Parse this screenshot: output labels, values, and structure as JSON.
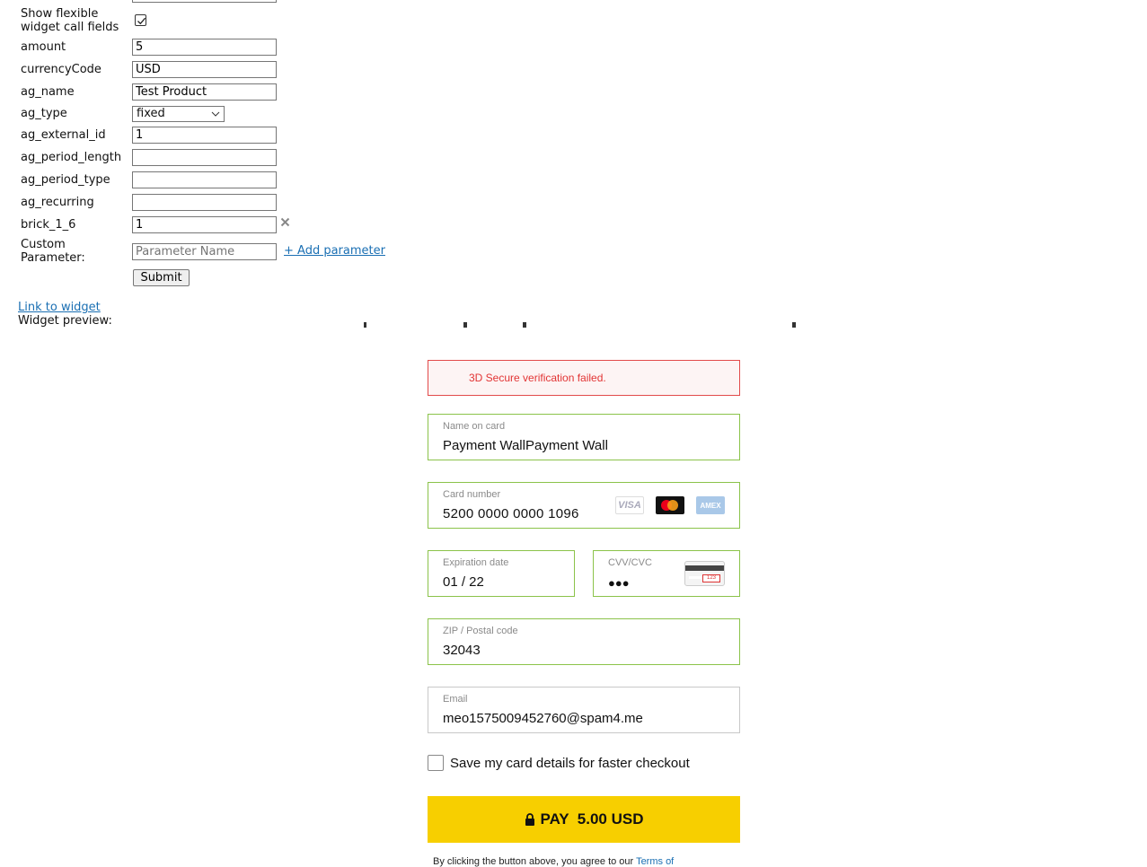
{
  "form": {
    "show_flexible_label_1": "Show flexible",
    "show_flexible_label_2": "widget call fields",
    "rows": [
      {
        "label": "amount",
        "value": "5"
      },
      {
        "label": "currencyCode",
        "value": "USD"
      },
      {
        "label": "ag_name",
        "value": "Test Product"
      },
      {
        "label": "ag_type",
        "value": "fixed"
      },
      {
        "label": "ag_external_id",
        "value": "1"
      },
      {
        "label": "ag_period_length",
        "value": ""
      },
      {
        "label": "ag_period_type",
        "value": ""
      },
      {
        "label": "ag_recurring",
        "value": ""
      },
      {
        "label": "brick_1_6",
        "value": "1"
      }
    ],
    "custom_param_label_1": "Custom",
    "custom_param_label_2": "Parameter:",
    "custom_param_placeholder": "Parameter Name",
    "add_parameter": "+ Add parameter",
    "submit": "Submit",
    "link_to_widget": "Link to widget",
    "widget_preview": "Widget preview:"
  },
  "widget": {
    "error": "3D Secure verification failed.",
    "name_label": "Name on card",
    "name_value": "Payment WallPayment Wall",
    "card_label": "Card number",
    "card_value": "5200 0000 0000 1096",
    "expiry_label": "Expiration date",
    "expiry_value": "01 / 22",
    "cvv_label": "CVV/CVC",
    "cvv_value": "●●●",
    "zip_label": "ZIP / Postal code",
    "zip_value": "32043",
    "email_label": "Email",
    "email_value": "meo1575009452760@spam4.me",
    "save_card": "Save my card details for faster checkout",
    "pay_button": "PAY  5.00 USD",
    "terms_prefix": "By clicking the button above, you agree to our",
    "terms_link": "Terms of",
    "card_brands": [
      "VISA",
      "mastercard",
      "AMEX"
    ]
  },
  "colors": {
    "accent_yellow": "#f7cf00",
    "valid_green": "#8bc34a",
    "error_red": "#e23434",
    "link_blue": "#1a6fb3"
  }
}
